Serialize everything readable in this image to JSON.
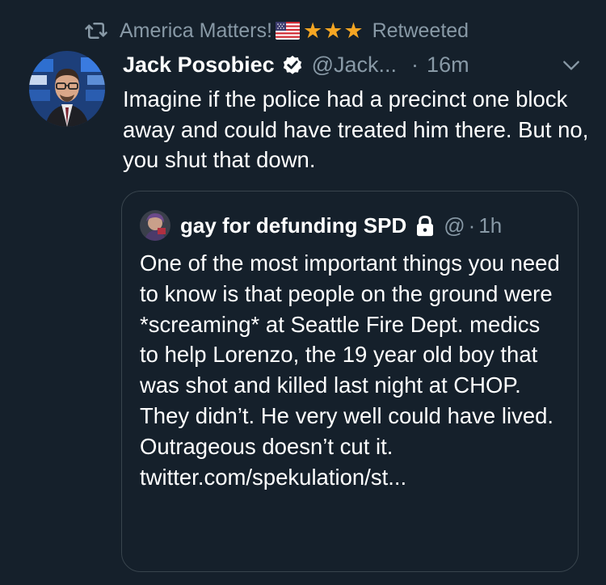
{
  "retweet": {
    "icon": "retweet-icon",
    "account_name": "America Matters!",
    "flag_icon": "us-flag-icon",
    "stars": "★★★",
    "label": "Retweeted"
  },
  "tweet": {
    "display_name": "Jack Posobiec",
    "verified_icon": "verified-badge-icon",
    "handle": "@Jack...",
    "separator": "·",
    "timestamp": "16m",
    "menu_icon": "chevron-down-icon",
    "text": "Imagine if the police had a precinct one block away and could have treated him there. But no, you shut that down."
  },
  "quote": {
    "display_name": "gay for defunding SPD",
    "lock_icon": "lock-icon",
    "handle": "@",
    "separator": "·",
    "timestamp": "1h",
    "text": "One of the most important things you need to know is that people on the ground were *screaming* at Seattle Fire Dept. medics to help Lorenzo, the 19 year old boy that was shot and killed last night at CHOP. They didn’t. He very well could have lived. Outrageous doesn’t cut it. twitter.com/spekulation/st..."
  },
  "colors": {
    "background": "#15202b",
    "secondary_text": "#8899a6",
    "border": "#38444d",
    "stars": "#f5a623"
  }
}
